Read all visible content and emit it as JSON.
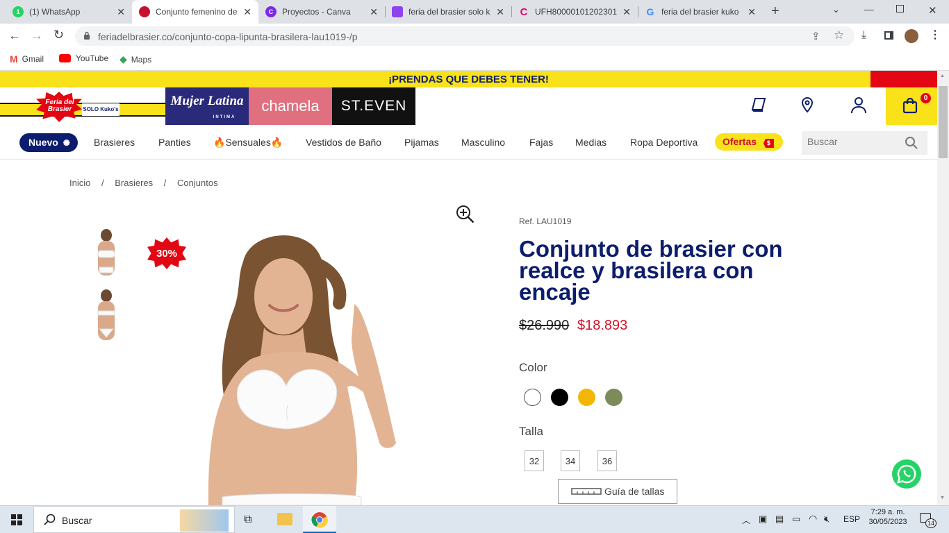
{
  "browser": {
    "tabs": [
      {
        "title": "(1) WhatsApp",
        "fav": "whatsapp",
        "close": "✕"
      },
      {
        "title": "Conjunto femenino de",
        "fav": "feria",
        "close": "✕"
      },
      {
        "title": "Proyectos - Canva",
        "fav": "canva",
        "close": "✕"
      },
      {
        "title": "feria del brasier solo k",
        "fav": "calendar",
        "close": "✕"
      },
      {
        "title": "UFH80000101202301",
        "fav": "cvendor",
        "close": "✕"
      },
      {
        "title": "feria del brasier kuko",
        "fav": "google",
        "close": "✕"
      }
    ],
    "new_tab": "+",
    "url": "feriadelbrasier.co/conjunto-copa-lipunta-brasilera-lau1019-/p",
    "bookmarks": [
      "Gmail",
      "YouTube",
      "Maps"
    ]
  },
  "site": {
    "promo": "¡PRENDAS QUE DEBES TENER!",
    "logo_text": "Feria del Brasier",
    "logo_sub": "SOLO Kuko's",
    "brands": [
      "Mujer Latina",
      "INTIMA",
      "chamela",
      "ST.EVEN"
    ],
    "cart_count": "0",
    "nav": {
      "nuevo": "Nuevo",
      "items": [
        "Brasieres",
        "Panties",
        "Sensuales",
        "Vestidos de Baño",
        "Pijamas",
        "Masculino",
        "Fajas",
        "Medias",
        "Ropa Deportiva"
      ],
      "ofertas": "Ofertas",
      "ofertas_badge": "$",
      "search_placeholder": "Buscar"
    },
    "breadcrumb": [
      "Inicio",
      "Brasieres",
      "Conjuntos"
    ],
    "breadcrumb_sep": "/"
  },
  "product": {
    "ref": "Ref. LAU1019",
    "title": "Conjunto de brasier con realce y brasilera con encaje",
    "old_price": "$26.990",
    "price": "$18.893",
    "discount": "30%",
    "color_label": "Color",
    "colors": [
      "#ffffff",
      "#000000",
      "#f2b705",
      "#7b8b5a"
    ],
    "size_label": "Talla",
    "sizes": [
      "32",
      "34",
      "36"
    ],
    "size_guide": "Guía de tallas"
  },
  "taskbar": {
    "search": "Buscar",
    "lang": "ESP",
    "time": "7:29 a. m.",
    "date": "30/05/2023",
    "notifications": "14"
  }
}
